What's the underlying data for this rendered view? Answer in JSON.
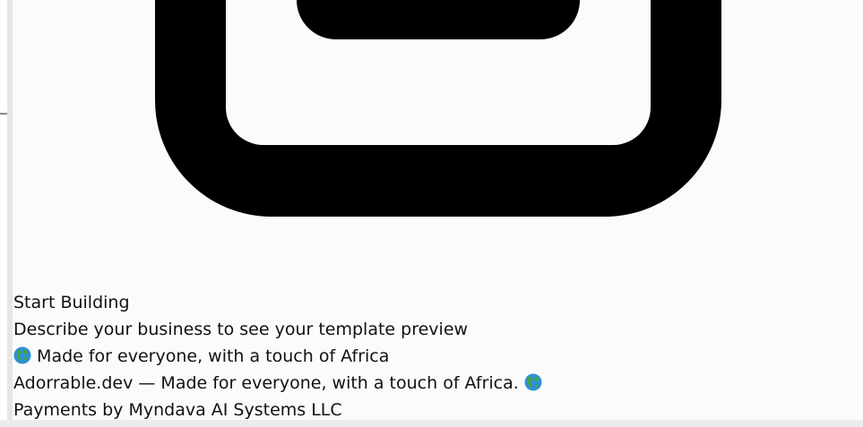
{
  "page": {
    "icon": "device-frame-icon",
    "lines": {
      "start_building": "Start Building",
      "describe": "Describe your business to see your template preview",
      "made_for_everyone": "Made for everyone, with a touch of Africa",
      "footer_tagline": "Adorrable.dev — Made for everyone, with a touch of Africa.",
      "payments": "Payments by Myndava AI Systems LLC"
    }
  },
  "colors": {
    "background": "#fbfbfb",
    "icon": "#000000",
    "text": "#111111",
    "globe_ocean": "#2f8fd8",
    "globe_land": "#3fa54a"
  }
}
